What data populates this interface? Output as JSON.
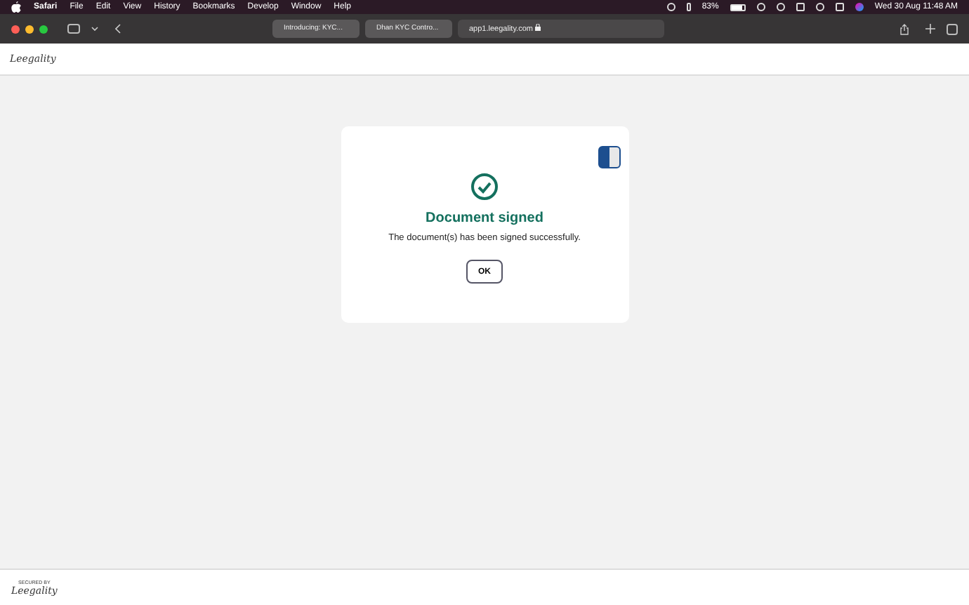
{
  "menu_bar": {
    "items": [
      "Safari",
      "File",
      "Edit",
      "View",
      "History",
      "Bookmarks",
      "Develop",
      "Window",
      "Help"
    ],
    "battery": "83%",
    "clock": "Wed 30 Aug  11:48 AM"
  },
  "browser": {
    "tabs": [
      {
        "label": "Introducing: KYC...",
        "selected": false
      },
      {
        "label": "Dhan KYC Contro...",
        "selected": false
      }
    ],
    "address": "app1.leegality.com"
  },
  "header": {
    "logo": "Leegality"
  },
  "dialog": {
    "title": "Document signed",
    "message": "The document(s) has been signed successfully.",
    "button": "OK"
  },
  "footer": {
    "caption": "SECURED BY",
    "logo": "Leegality"
  }
}
